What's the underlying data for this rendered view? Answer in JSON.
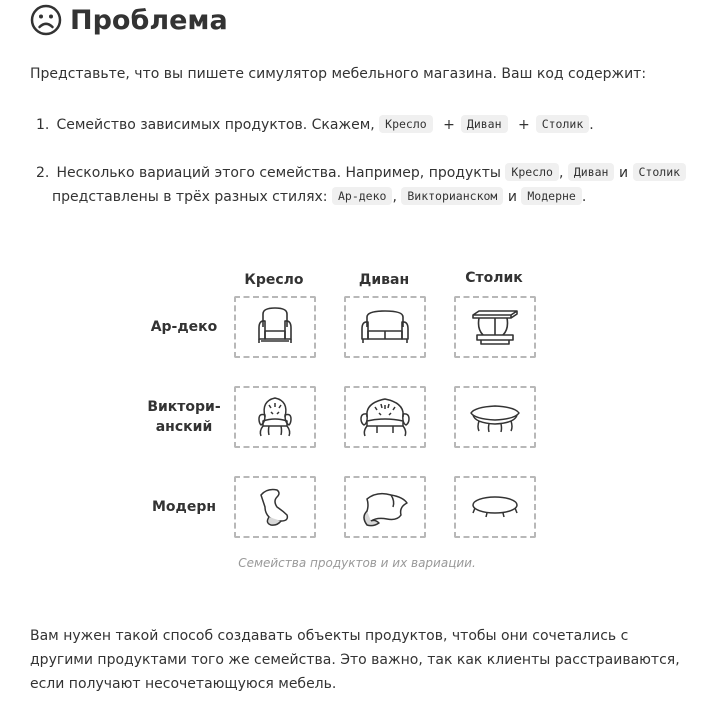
{
  "heading": {
    "title": "Проблема",
    "icon": "sad-face-icon"
  },
  "intro": "Представьте, что вы пишете симулятор мебельного магазина. Ваш код содержит:",
  "list": {
    "item1": {
      "number": "1.",
      "text": "Семейство зависимых продуктов. Скажем,",
      "codes": [
        "Кресло",
        "Диван",
        "Столик"
      ],
      "plus": "+",
      "end": "."
    },
    "item2": {
      "number": "2.",
      "text1": "Несколько вариаций этого семейства. Например, продукты",
      "codes1": [
        "Кресло",
        "Диван",
        "Столик"
      ],
      "comma": ",",
      "and": "и",
      "text2": "представлены в трёх разных стилях:",
      "codes2": [
        "Ар-деко",
        "Викторианском",
        "Модерне"
      ],
      "end": "."
    }
  },
  "figure": {
    "columns": [
      "Кресло",
      "Диван",
      "Столик"
    ],
    "rows": [
      {
        "label": "Ар-деко"
      },
      {
        "label1": "Виктори-",
        "label2": "анский"
      },
      {
        "label": "Модерн"
      }
    ],
    "icons": [
      [
        "artdeco-armchair-icon",
        "artdeco-sofa-icon",
        "artdeco-coffee-table-icon"
      ],
      [
        "victorian-armchair-icon",
        "victorian-sofa-icon",
        "victorian-coffee-table-icon"
      ],
      [
        "modern-armchair-icon",
        "modern-sofa-icon",
        "modern-coffee-table-icon"
      ]
    ],
    "caption": "Семейства продуктов и их вариации."
  },
  "outro": "Вам нужен такой способ создавать объекты продуктов, чтобы они сочетались с другими продуктами того же семейства. Это важно, так как клиенты расстраиваются, если получают несочетающуюся мебель."
}
